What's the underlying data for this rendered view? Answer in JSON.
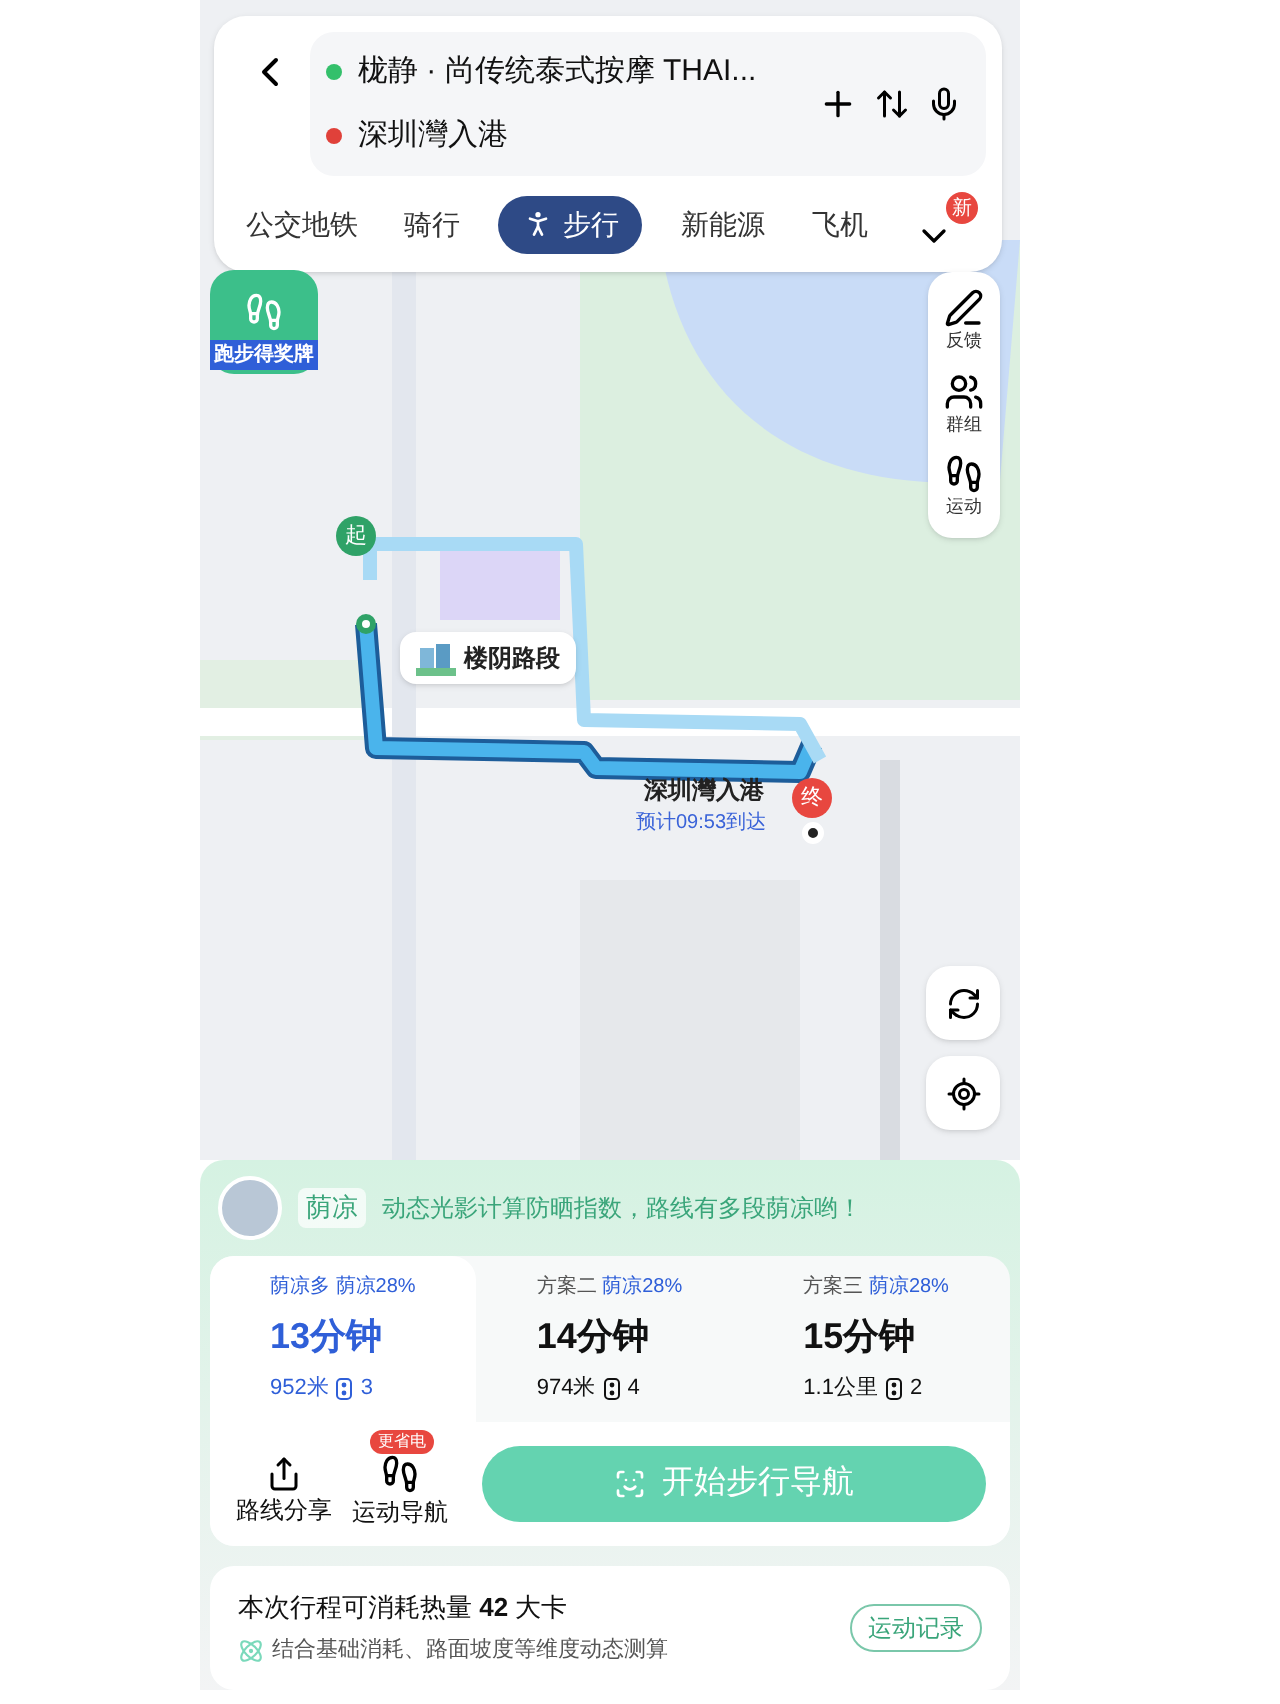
{
  "header": {
    "origin": "栊静 · 尚传统泰式按摩 THAI...",
    "destination": "深圳灣入港"
  },
  "modes": [
    {
      "label": "公交地铁",
      "selected": false
    },
    {
      "label": "骑行",
      "selected": false
    },
    {
      "label": "步行",
      "selected": true
    },
    {
      "label": "新能源",
      "selected": false
    },
    {
      "label": "飞机",
      "selected": false
    }
  ],
  "more_badge": "新",
  "map": {
    "badge": "跑步得奖牌",
    "tools": [
      {
        "kind": "feedback",
        "label": "反馈"
      },
      {
        "kind": "group",
        "label": "群组"
      },
      {
        "kind": "sport",
        "label": "运动"
      }
    ],
    "start_marker": "起",
    "end_marker": "终",
    "callout": "楼阴路段",
    "destination_label": "深圳灣入港",
    "eta": "预计09:53到达"
  },
  "shade_banner": {
    "tag": "荫凉",
    "text": "动态光影计算防晒指数，路线有多段荫凉哟！"
  },
  "routes": [
    {
      "tag": "荫凉多",
      "shade": "荫凉28%",
      "time": "13分钟",
      "distance": "952米",
      "lights": "3",
      "selected": true
    },
    {
      "tag": "方案二",
      "shade": "荫凉28%",
      "time": "14分钟",
      "distance": "974米",
      "lights": "4",
      "selected": false
    },
    {
      "tag": "方案三",
      "shade": "荫凉28%",
      "time": "15分钟",
      "distance": "1.1公里",
      "lights": "2",
      "selected": false
    }
  ],
  "actions": [
    {
      "kind": "share",
      "label": "路线分享"
    },
    {
      "kind": "sport",
      "label": "运动导航",
      "badge": "更省电"
    }
  ],
  "start_button": "开始步行导航",
  "calories": {
    "text": "本次行程可消耗热量 **42** 大卡",
    "note": "结合基础消耗、路面坡度等维度动态测算",
    "button": "运动记录"
  }
}
